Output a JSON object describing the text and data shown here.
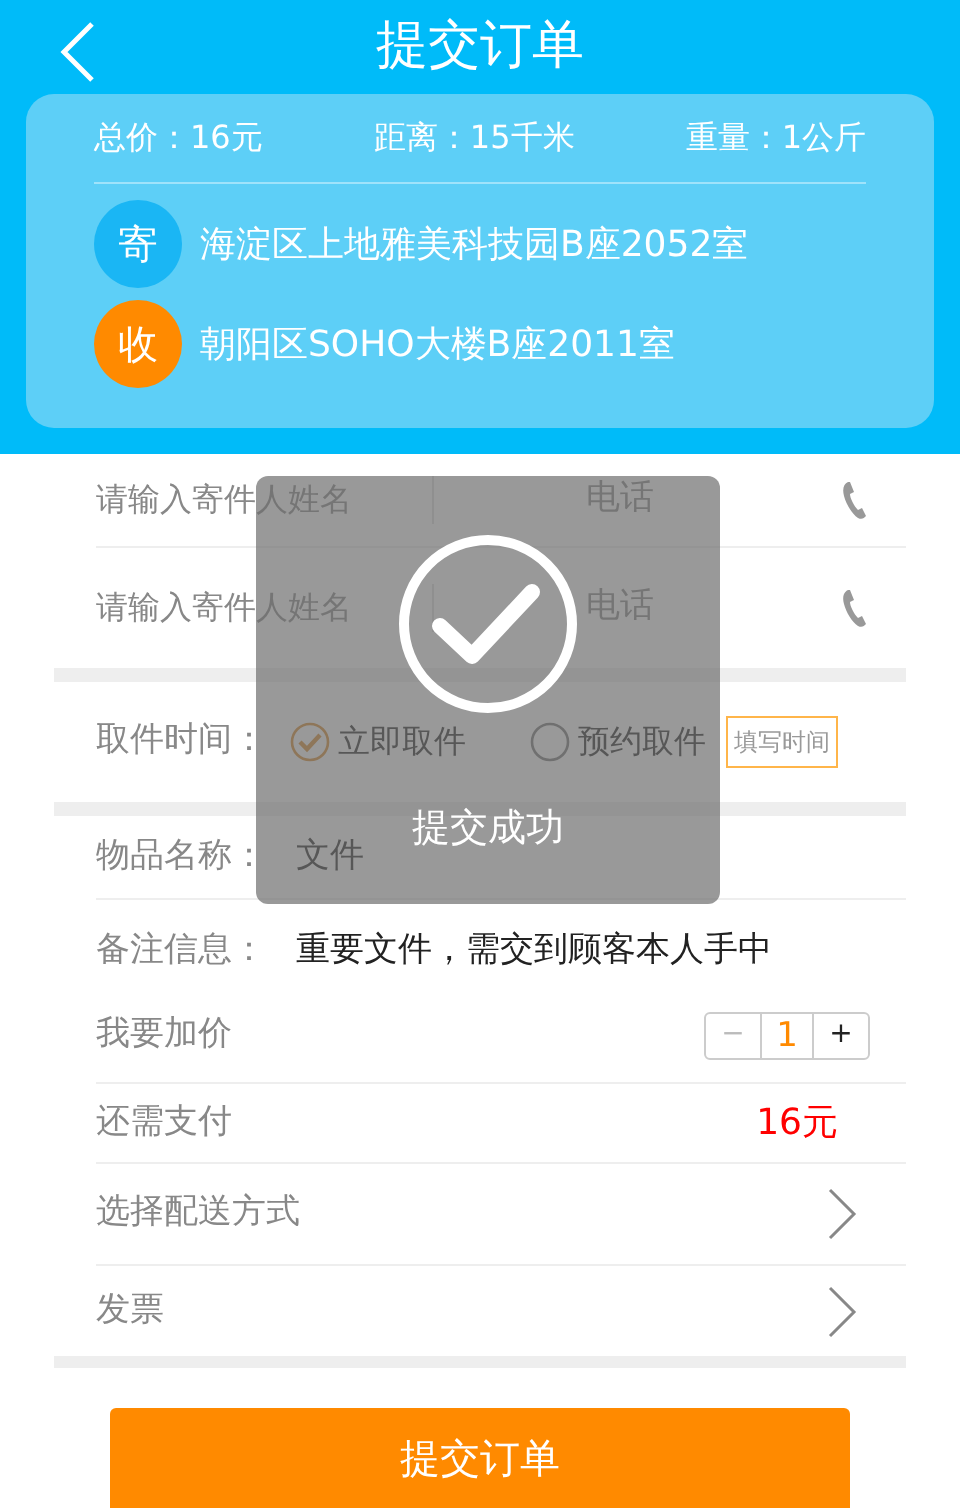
{
  "header": {
    "title": "提交订单"
  },
  "summary": [
    "总价：16元",
    "距离：15千米",
    "重量：1公斤"
  ],
  "addresses": [
    {
      "badge": "寄",
      "text": "海淀区上地雅美科技园B座2052室",
      "color": "#1ab6f4"
    },
    {
      "badge": "收",
      "text": "朝阳区SOHO大楼B座2011室",
      "color": "#ff8a00"
    }
  ],
  "contacts": [
    {
      "name_placeholder": "请输入寄件人姓名",
      "phone_placeholder": "电话"
    },
    {
      "name_placeholder": "请输入寄件人姓名",
      "phone_placeholder": "电话"
    }
  ],
  "pickup": {
    "label": "取件时间：",
    "options": [
      {
        "label": "立即取件",
        "selected": true
      },
      {
        "label": "预约取件",
        "selected": false
      }
    ],
    "time_button": "填写时间"
  },
  "item": {
    "label": "物品名称：",
    "value": "文件"
  },
  "notes": {
    "label": "备注信息：",
    "value": "重要文件，需交到顾客本人手中"
  },
  "extra": {
    "label": "我要加价",
    "minus": "−",
    "value": "1",
    "plus": "+"
  },
  "payment": {
    "label": "还需支付",
    "value": "16元"
  },
  "links": [
    "选择配送方式",
    "发票"
  ],
  "submit": "提交订单",
  "toast": {
    "message": "提交成功"
  }
}
